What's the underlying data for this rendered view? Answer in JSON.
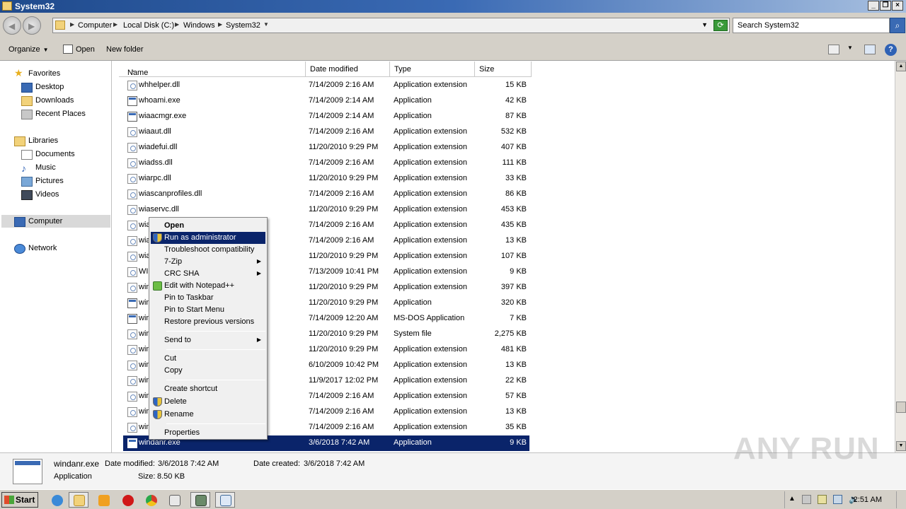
{
  "window": {
    "title": "System32"
  },
  "address": {
    "crumbs": [
      "Computer",
      "Local Disk (C:)",
      "Windows",
      "System32"
    ]
  },
  "search": {
    "placeholder": "Search System32"
  },
  "toolbar": {
    "organize": "Organize",
    "open": "Open",
    "new_folder": "New folder"
  },
  "nav": {
    "favorites": "Favorites",
    "favorites_items": [
      "Desktop",
      "Downloads",
      "Recent Places"
    ],
    "libraries": "Libraries",
    "libraries_items": [
      "Documents",
      "Music",
      "Pictures",
      "Videos"
    ],
    "computer": "Computer",
    "network": "Network"
  },
  "columns": {
    "name": "Name",
    "date": "Date modified",
    "type": "Type",
    "size": "Size"
  },
  "files": [
    {
      "name": "whhelper.dll",
      "date": "7/14/2009 2:16 AM",
      "type": "Application extension",
      "size": "15 KB",
      "kind": "dll"
    },
    {
      "name": "whoami.exe",
      "date": "7/14/2009 2:14 AM",
      "type": "Application",
      "size": "42 KB",
      "kind": "exe"
    },
    {
      "name": "wiaacmgr.exe",
      "date": "7/14/2009 2:14 AM",
      "type": "Application",
      "size": "87 KB",
      "kind": "exe"
    },
    {
      "name": "wiaaut.dll",
      "date": "7/14/2009 2:16 AM",
      "type": "Application extension",
      "size": "532 KB",
      "kind": "dll"
    },
    {
      "name": "wiadefui.dll",
      "date": "11/20/2010 9:29 PM",
      "type": "Application extension",
      "size": "407 KB",
      "kind": "dll"
    },
    {
      "name": "wiadss.dll",
      "date": "7/14/2009 2:16 AM",
      "type": "Application extension",
      "size": "111 KB",
      "kind": "dll"
    },
    {
      "name": "wiarpc.dll",
      "date": "11/20/2010 9:29 PM",
      "type": "Application extension",
      "size": "33 KB",
      "kind": "dll"
    },
    {
      "name": "wiascanprofiles.dll",
      "date": "7/14/2009 2:16 AM",
      "type": "Application extension",
      "size": "86 KB",
      "kind": "dll"
    },
    {
      "name": "wiaservc.dll",
      "date": "11/20/2010 9:29 PM",
      "type": "Application extension",
      "size": "453 KB",
      "kind": "dll"
    },
    {
      "name": "wia",
      "date": "7/14/2009 2:16 AM",
      "type": "Application extension",
      "size": "435 KB",
      "kind": "dll"
    },
    {
      "name": "wia",
      "date": "7/14/2009 2:16 AM",
      "type": "Application extension",
      "size": "13 KB",
      "kind": "dll"
    },
    {
      "name": "wia",
      "date": "11/20/2010 9:29 PM",
      "type": "Application extension",
      "size": "107 KB",
      "kind": "dll"
    },
    {
      "name": "WI",
      "date": "7/13/2009 10:41 PM",
      "type": "Application extension",
      "size": "9 KB",
      "kind": "dll"
    },
    {
      "name": "win",
      "date": "11/20/2010 9:29 PM",
      "type": "Application extension",
      "size": "397 KB",
      "kind": "dll"
    },
    {
      "name": "win",
      "date": "11/20/2010 9:29 PM",
      "type": "Application",
      "size": "320 KB",
      "kind": "exe"
    },
    {
      "name": "win",
      "date": "7/14/2009 12:20 AM",
      "type": "MS-DOS Application",
      "size": "7 KB",
      "kind": "exe"
    },
    {
      "name": "win",
      "date": "11/20/2010 9:29 PM",
      "type": "System file",
      "size": "2,275 KB",
      "kind": "dll"
    },
    {
      "name": "win",
      "date": "11/20/2010 9:29 PM",
      "type": "Application extension",
      "size": "481 KB",
      "kind": "dll"
    },
    {
      "name": "win",
      "date": "6/10/2009 10:42 PM",
      "type": "Application extension",
      "size": "13 KB",
      "kind": "dll"
    },
    {
      "name": "win",
      "date": "11/9/2017 12:02 PM",
      "type": "Application extension",
      "size": "22 KB",
      "kind": "dll"
    },
    {
      "name": "win",
      "date": "7/14/2009 2:16 AM",
      "type": "Application extension",
      "size": "57 KB",
      "kind": "dll"
    },
    {
      "name": "win",
      "date": "7/14/2009 2:16 AM",
      "type": "Application extension",
      "size": "13 KB",
      "kind": "dll"
    },
    {
      "name": "win",
      "date": "7/14/2009 2:16 AM",
      "type": "Application extension",
      "size": "35 KB",
      "kind": "dll"
    },
    {
      "name": "windanr.exe",
      "date": "3/6/2018 7:42 AM",
      "type": "Application",
      "size": "9 KB",
      "kind": "exe",
      "selected": true
    }
  ],
  "context_menu": [
    {
      "label": "Open",
      "bold": true
    },
    {
      "label": "Run as administrator",
      "icon": "shield-icon",
      "highlighted": true
    },
    {
      "label": "Troubleshoot compatibility"
    },
    {
      "label": "7-Zip",
      "submenu": true
    },
    {
      "label": "CRC SHA",
      "submenu": true
    },
    {
      "label": "Edit with Notepad++",
      "icon": "notepadpp-icon"
    },
    {
      "label": "Pin to Taskbar"
    },
    {
      "label": "Pin to Start Menu"
    },
    {
      "label": "Restore previous versions"
    },
    {
      "label": "Send to",
      "submenu": true
    },
    {
      "label": "Cut"
    },
    {
      "label": "Copy"
    },
    {
      "label": "Create shortcut"
    },
    {
      "label": "Delete",
      "icon": "shield-icon"
    },
    {
      "label": "Rename",
      "icon": "shield-icon"
    },
    {
      "label": "Properties"
    }
  ],
  "details": {
    "name": "windanr.exe",
    "type": "Application",
    "date_modified_label": "Date modified:",
    "date_modified": "3/6/2018 7:42 AM",
    "date_created_label": "Date created:",
    "date_created": "3/6/2018 7:42 AM",
    "size_label": "Size:",
    "size": "8.50 KB"
  },
  "watermark": "ANY RUN",
  "taskbar": {
    "start": "Start",
    "clock": "2:51 AM"
  },
  "colors": {
    "selection": "#0a246a",
    "titlebar": "#1f4a8c",
    "chrome": "#d4d0c8"
  }
}
